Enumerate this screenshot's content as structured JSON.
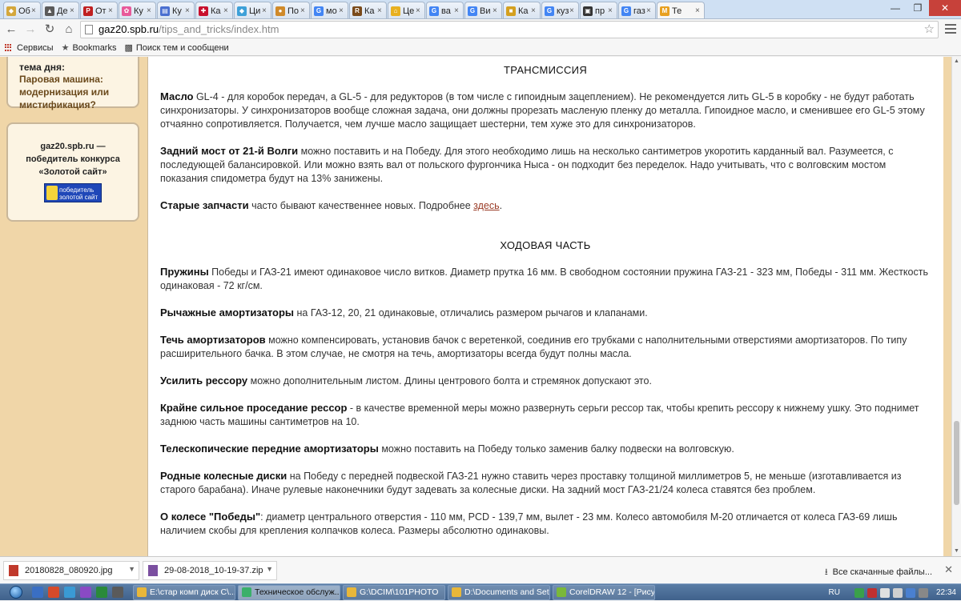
{
  "browser": {
    "tabs": [
      {
        "label": "Об",
        "color": "#d4a73c",
        "glyph": "◆"
      },
      {
        "label": "Де",
        "color": "#5a5a5a",
        "glyph": "▲"
      },
      {
        "label": "От",
        "color": "#c02020",
        "glyph": "P"
      },
      {
        "label": "Ку",
        "color": "#e85a9a",
        "glyph": "✿"
      },
      {
        "label": "Ку",
        "color": "#4a6fd0",
        "glyph": "▤"
      },
      {
        "label": "Ка",
        "color": "#c8102e",
        "glyph": "✚"
      },
      {
        "label": "Ци",
        "color": "#3da0d8",
        "glyph": "◆"
      },
      {
        "label": "По",
        "color": "#d08a2a",
        "glyph": "●"
      },
      {
        "label": "мо",
        "color": "#4285f4",
        "glyph": "G"
      },
      {
        "label": "Ка",
        "color": "#7a4a1a",
        "glyph": "R"
      },
      {
        "label": "Це",
        "color": "#e8b020",
        "glyph": "⌂"
      },
      {
        "label": "ва",
        "color": "#4285f4",
        "glyph": "G"
      },
      {
        "label": "Ви",
        "color": "#4285f4",
        "glyph": "G"
      },
      {
        "label": "Ка",
        "color": "#d4a020",
        "glyph": "■"
      },
      {
        "label": "куз",
        "color": "#4285f4",
        "glyph": "G"
      },
      {
        "label": "пр",
        "color": "#333333",
        "glyph": "▣"
      },
      {
        "label": "газ",
        "color": "#4285f4",
        "glyph": "G"
      },
      {
        "label": "Те",
        "color": "#e8a020",
        "glyph": "M",
        "active": true
      }
    ],
    "address": {
      "host": "gaz20.spb.ru",
      "path": "/tips_and_tricks/index.htm"
    },
    "bookmarks": [
      {
        "label": "Сервисы",
        "icon": "apps-grid-icon"
      },
      {
        "label": "Bookmarks",
        "icon": "star-icon"
      },
      {
        "label": "Поиск тем и сообщени",
        "icon": "car-icon"
      }
    ]
  },
  "sidebar": {
    "box1_heading": "тема дня:",
    "box1_link_lines": [
      "Паровая машина:",
      "модернизация или",
      "мистификация?"
    ],
    "box2_lines": [
      "gaz20.spb.ru —",
      "победитель конкурса",
      "«Золотой сайт»"
    ],
    "badge_line1": "победитель",
    "badge_line2": "золотой сайт"
  },
  "content": {
    "heading1": "ТРАНСМИССИЯ",
    "section1": [
      {
        "bold": "Масло",
        "text": " GL-4 - для коробок передач, а GL-5 - для редукторов (в том числе с гипоидным зацеплением). Не рекомендуется лить GL-5 в коробку - не будут работать синхронизаторы. У синхронизаторов вообще сложная задача, они должны прорезать масленую пленку до металла. Гипоидное масло, и сменившее его GL-5 этому отчаянно сопротивляется. Получается, чем лучше масло защищает шестерни, тем хуже это для синхронизаторов."
      },
      {
        "bold": "Задний мост от 21-й Волги",
        "text": " можно поставить и на Победу. Для этого необходимо лишь на несколько сантиметров укоротить карданный вал. Разумеется, с последующей балансировкой. Или можно взять вал от польского фургончика Ныса - он подходит без переделок. Надо учитывать, что с волговским мостом показания спидометра будут на 13% занижены."
      },
      {
        "bold": "Старые запчасти",
        "text": " часто бывают качественнее новых. Подробнее ",
        "link": "здесь",
        "tail": "."
      }
    ],
    "heading2": "ХОДОВАЯ ЧАСТЬ",
    "section2": [
      {
        "bold": "Пружины",
        "text": " Победы и ГАЗ-21 имеют одинаковое число витков. Диаметр прутка 16 мм. В свободном состоянии пружина ГАЗ-21 - 323 мм, Победы - 311 мм. Жесткость одинаковая - 72 кг/см."
      },
      {
        "bold": "Рычажные амортизаторы",
        "text": " на ГАЗ-12, 20, 21 одинаковые, отличались размером рычагов и клапанами."
      },
      {
        "bold": "Течь амортизаторов",
        "text": " можно компенсировать, установив бачок с веретенкой, соединив его трубками с наполнительными отверстиями амортизаторов. По типу расширительного бачка. В этом случае, не смотря на течь, амортизаторы всегда будут полны масла."
      },
      {
        "bold": "Усилить рессору",
        "text": " можно дополнительным листом. Длины центрового болта и стремянок допускают это."
      },
      {
        "bold": "Крайне сильное проседание рессор",
        "text": " - в качестве временной меры можно развернуть серьги рессор так, чтобы крепить рессору к нижнему ушку. Это поднимет заднюю часть машины сантиметров на 10."
      },
      {
        "bold": "Телескопические передние амортизаторы",
        "text": " можно поставить на Победу только заменив балку подвески на волговскую."
      },
      {
        "bold": "Родные колесные диски",
        "text": " на Победу с передней подвеской ГАЗ-21 нужно ставить через проставку толщиной миллиметров 5, не меньше (изготавливается из старого барабана). Иначе рулевые наконечники будут задевать за колесные диски. На задний мост ГАЗ-21/24 колеса ставятся без проблем."
      },
      {
        "bold": "О колесе \"Победы\"",
        "text": ": диаметр центрального отверстия - 110 мм, PCD - 139,7 мм, вылет - 23 мм. Колесо автомобиля М-20 отличается от колеса ГАЗ-69 лишь наличием скобы для крепления колпачков колеса. Размеры абсолютно одинаковы."
      }
    ]
  },
  "downloads": {
    "items": [
      {
        "name": "20180828_080920.jpg",
        "color": "#c0392b"
      },
      {
        "name": "29-08-2018_10-19-37.zip",
        "color": "#7b4fa0"
      }
    ],
    "show_all": "Все скачанные файлы..."
  },
  "taskbar": {
    "quicklaunch": [
      "#3a6fc4",
      "#d64a2a",
      "#3a9ad4",
      "#8a4ac4",
      "#2a8a3a",
      "#5a5a5a"
    ],
    "buttons": [
      {
        "label": "E:\\стар комп диск C\\...",
        "color": "#e8b73a"
      },
      {
        "label": "Техническое обслуж...",
        "color": "#3ab06a",
        "active": true
      },
      {
        "label": "G:\\DCIM\\101PHOTO",
        "color": "#e8b73a"
      },
      {
        "label": "D:\\Documents and Set...",
        "color": "#e8b73a"
      },
      {
        "label": "CorelDRAW 12 - [Рису...",
        "color": "#7ab83a"
      }
    ],
    "language": "RU",
    "clock": "22:34"
  }
}
